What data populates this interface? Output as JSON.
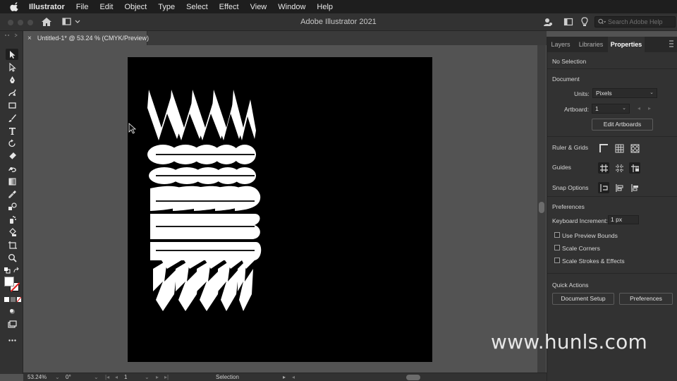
{
  "menubar": {
    "app": "Illustrator",
    "items": [
      "File",
      "Edit",
      "Object",
      "Type",
      "Select",
      "Effect",
      "View",
      "Window",
      "Help"
    ]
  },
  "appbar": {
    "title": "Adobe Illustrator 2021",
    "search_placeholder": "Search Adobe Help"
  },
  "document_tab": {
    "close": "×",
    "title": "Untitled-1* @ 53.24 % (CMYK/Preview)"
  },
  "tools": [
    "selection-tool",
    "direct-selection-tool",
    "pen-tool",
    "curvature-tool",
    "rectangle-tool",
    "paintbrush-tool",
    "type-tool",
    "rotate-tool",
    "eraser-tool",
    "warp-tool",
    "gradient-tool",
    "eyedropper-tool",
    "blend-tool",
    "symbol-sprayer-tool",
    "live-paint-bucket-tool",
    "artboard-tool",
    "zoom-tool"
  ],
  "statusbar": {
    "zoom": "53.24%",
    "rotation": "0°",
    "artboard": "1",
    "tool": "Selection"
  },
  "panel": {
    "tabs": [
      "Layers",
      "Libraries",
      "Properties"
    ],
    "active_tab": "Properties",
    "selection": "No Selection",
    "document": {
      "heading": "Document",
      "units_label": "Units:",
      "units_value": "Pixels",
      "artboard_label": "Artboard:",
      "artboard_value": "1",
      "edit_artboards": "Edit Artboards"
    },
    "ruler_grids": "Ruler & Grids",
    "guides": "Guides",
    "snap_options": "Snap Options",
    "preferences": {
      "heading": "Preferences",
      "keyboard_increment_label": "Keyboard Increment:",
      "keyboard_increment_value": "1 px",
      "checkboxes": [
        "Use Preview Bounds",
        "Scale Corners",
        "Scale Strokes & Effects"
      ]
    },
    "quick_actions": {
      "heading": "Quick Actions",
      "document_setup": "Document Setup",
      "preferences": "Preferences"
    }
  },
  "watermark": "www.hunls.com",
  "colors": {
    "menubar": "#1e1e1e",
    "chrome": "#323232",
    "canvas": "#535353",
    "artboard": "#000000",
    "artwork": "#ffffff"
  }
}
